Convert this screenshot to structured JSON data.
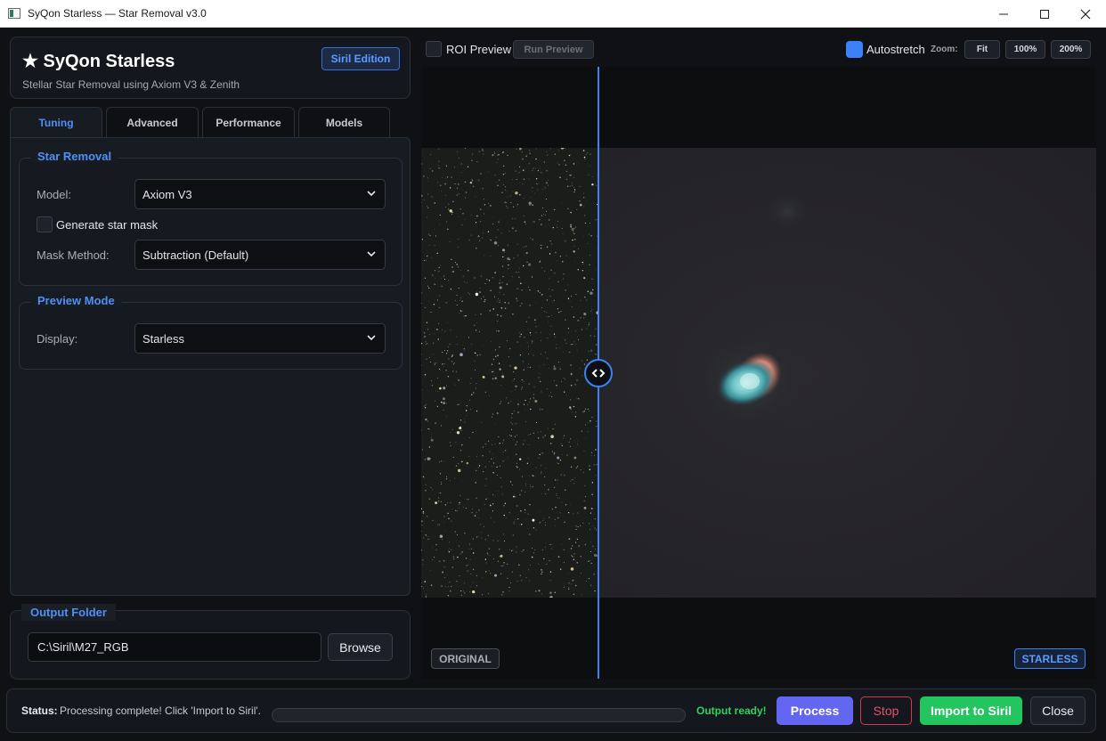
{
  "window": {
    "title": "SyQon Starless — Star Removal v3.0"
  },
  "header": {
    "app_name": "★ SyQon Starless",
    "subtitle": "Stellar Star Removal using Axiom V3 & Zenith",
    "edition_badge": "Siril Edition"
  },
  "tabs": [
    {
      "label": "Tuning",
      "active": true
    },
    {
      "label": "Advanced",
      "active": false
    },
    {
      "label": "Performance",
      "active": false
    },
    {
      "label": "Models",
      "active": false
    }
  ],
  "star_removal": {
    "title": "Star Removal",
    "model_label": "Model:",
    "model_value": "Axiom V3",
    "star_mask_label": "Generate star mask",
    "star_mask_checked": false,
    "mask_method_label": "Mask Method:",
    "mask_method_value": "Subtraction (Default)"
  },
  "preview_mode": {
    "title": "Preview Mode",
    "display_label": "Display:",
    "display_value": "Starless"
  },
  "output": {
    "title": "Output Folder",
    "path": "C:\\Siril\\M27_RGB",
    "browse_label": "Browse"
  },
  "preview_toolbar": {
    "roi_label": "ROI Preview",
    "roi_checked": false,
    "run_preview_label": "Run Preview",
    "autostretch_label": "Autostretch",
    "autostretch_checked": true,
    "zoom_label": "Zoom:",
    "zoom_buttons": [
      "Fit",
      "100%",
      "200%"
    ]
  },
  "preview": {
    "original_tag": "ORIGINAL",
    "starless_tag": "STARLESS",
    "split_handle_icon": "split-arrows-icon"
  },
  "status": {
    "label": "Status:",
    "text": "Processing complete! Click 'Import to Siril'.",
    "progress": 0,
    "output_ready": "Output ready!",
    "process_label": "Process",
    "stop_label": "Stop",
    "import_label": "Import to Siril",
    "close_label": "Close"
  },
  "colors": {
    "accent": "#3b82f6",
    "process": "#6366f1",
    "import": "#22c55e",
    "stop": "#d63a4a",
    "ready": "#2fd35b"
  }
}
